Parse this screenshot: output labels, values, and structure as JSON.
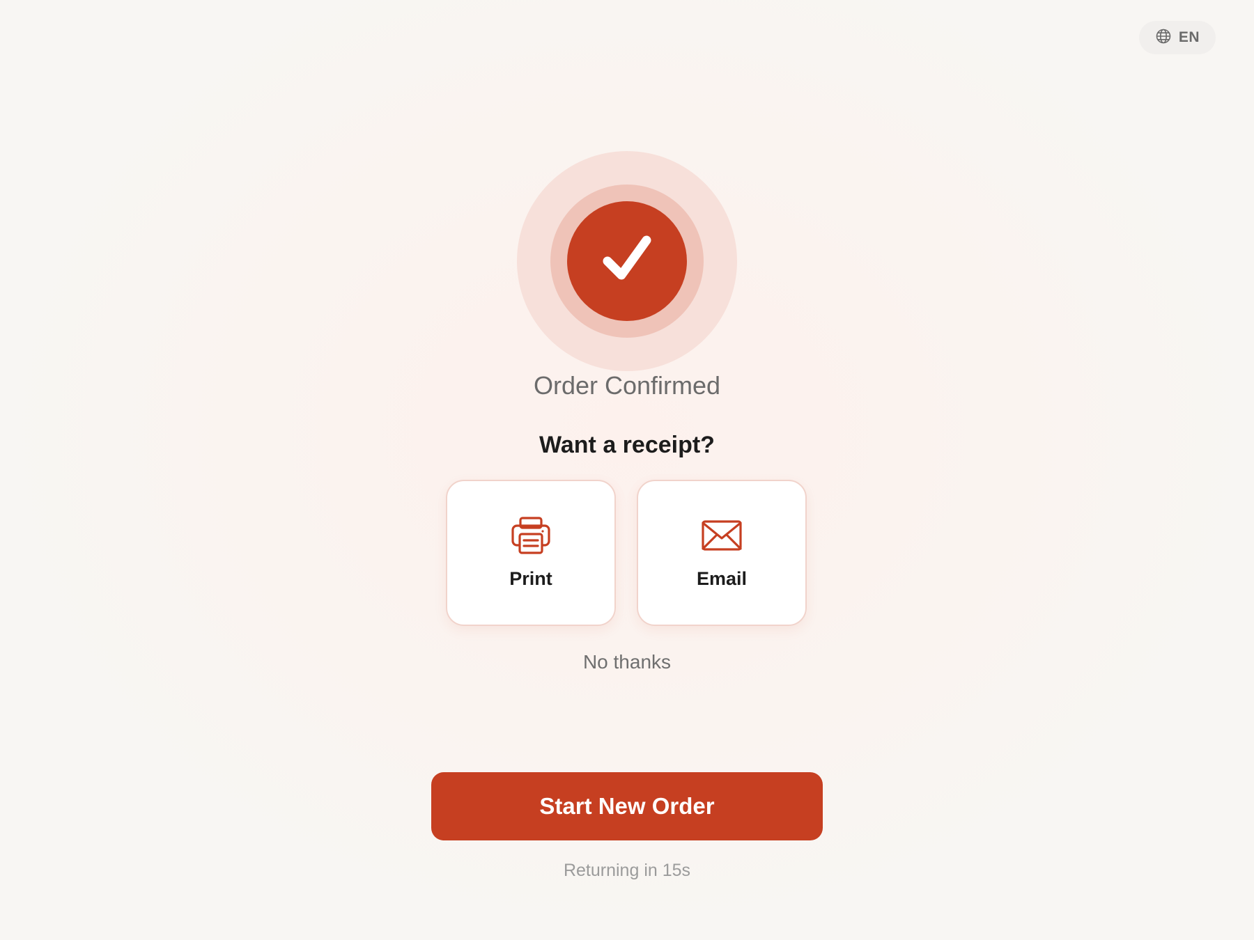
{
  "language": {
    "icon": "globe-icon",
    "code": "EN"
  },
  "status": {
    "icon": "checkmark-icon",
    "title": "Order Confirmed"
  },
  "receipt": {
    "question": "Want a receipt?",
    "options": [
      {
        "label": "Print",
        "icon": "printer-icon"
      },
      {
        "label": "Email",
        "icon": "envelope-icon"
      }
    ],
    "decline_label": "No thanks"
  },
  "actions": {
    "primary_label": "Start New Order",
    "countdown_text": "Returning in 15s"
  },
  "colors": {
    "accent": "#c63f21",
    "accent_ring_inner": "#efc3b8",
    "accent_ring_outer": "#f7e0da",
    "background": "#fbf3ef"
  }
}
